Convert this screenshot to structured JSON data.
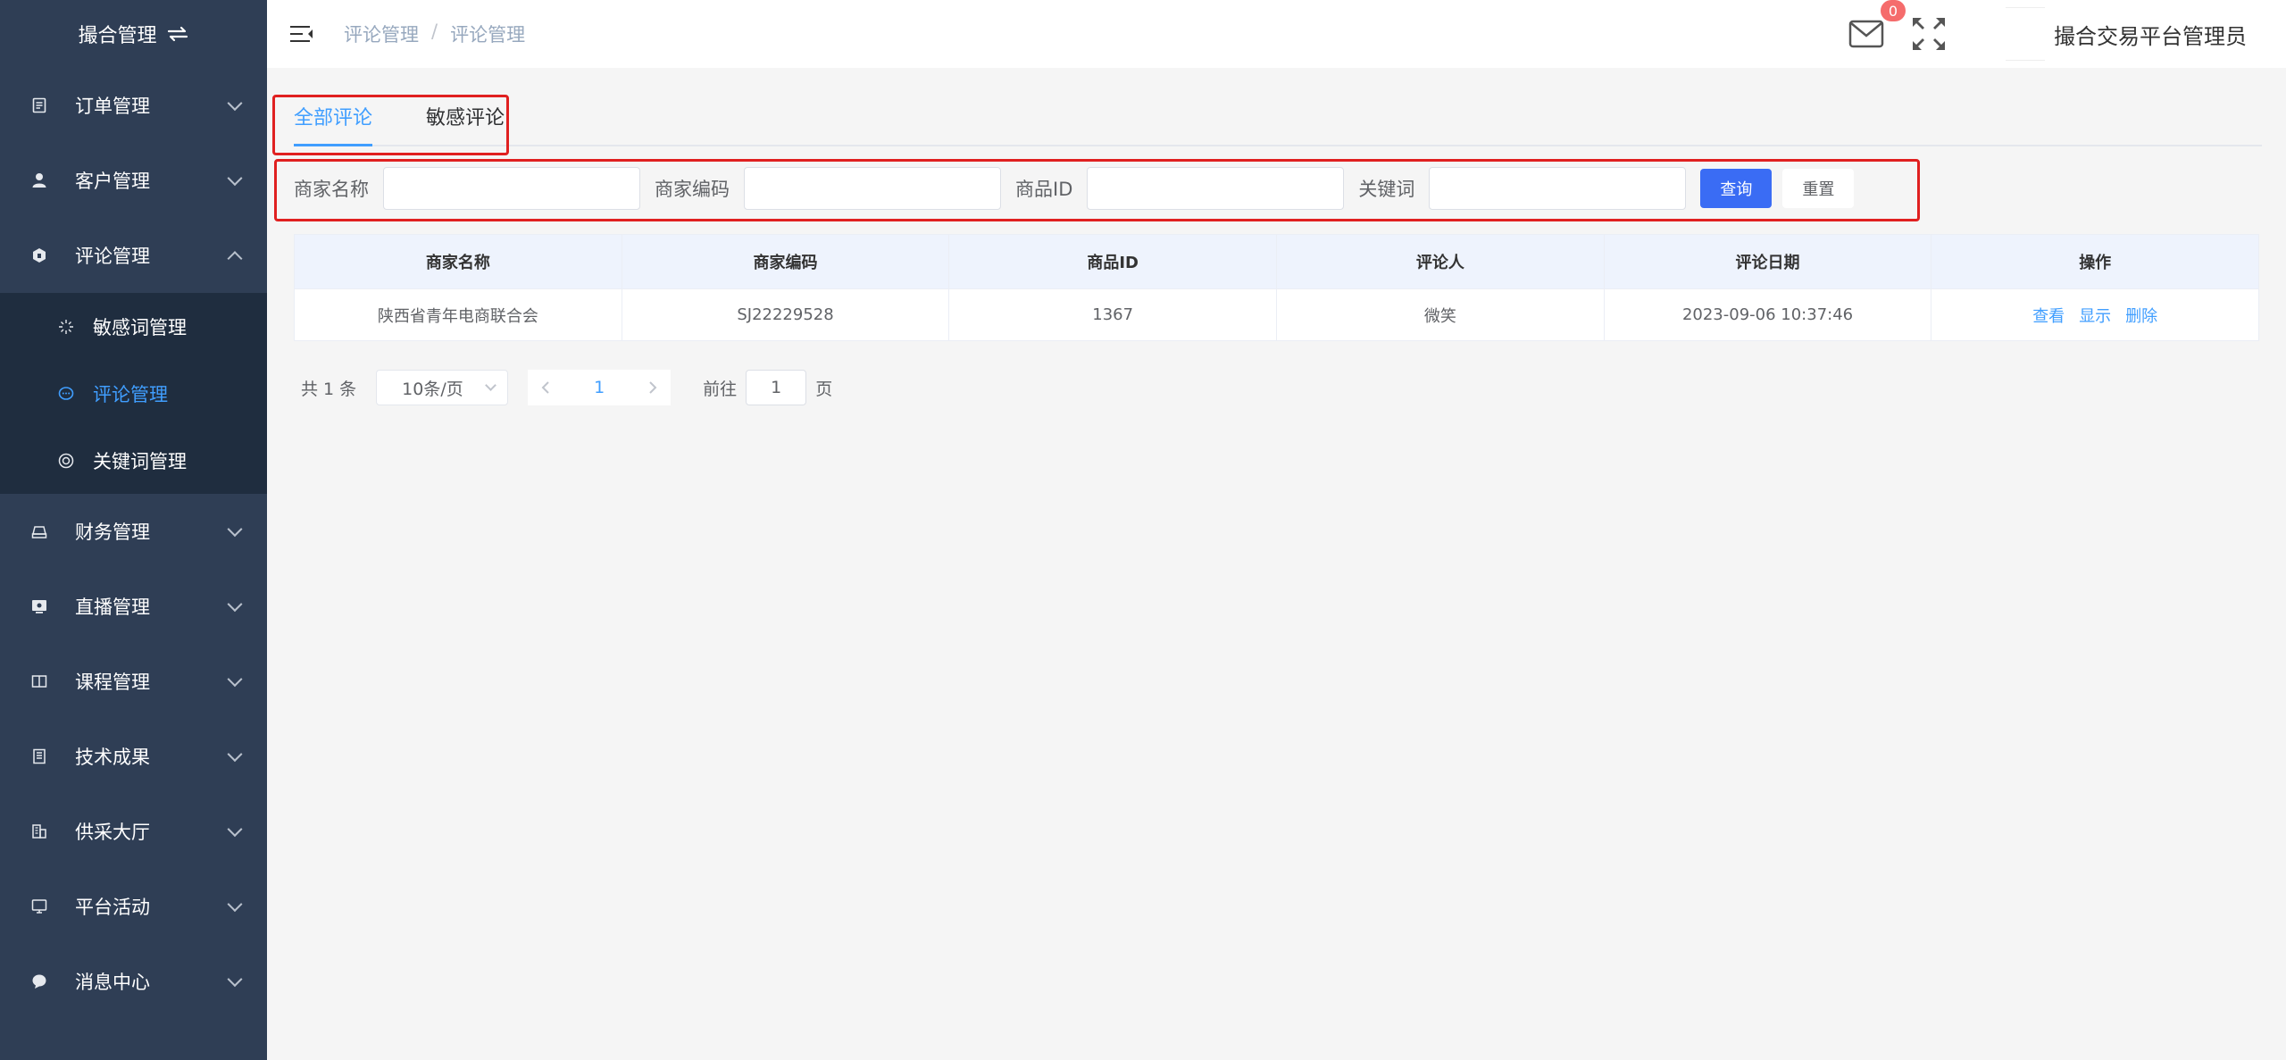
{
  "sidebar": {
    "brand": "撮合管理",
    "items": [
      {
        "label": "订单管理",
        "icon": "document-icon"
      },
      {
        "label": "客户管理",
        "icon": "user-icon"
      },
      {
        "label": "评论管理",
        "icon": "comment-box-icon"
      },
      {
        "label": "财务管理",
        "icon": "finance-icon"
      },
      {
        "label": "直播管理",
        "icon": "live-icon"
      },
      {
        "label": "课程管理",
        "icon": "book-icon"
      },
      {
        "label": "技术成果",
        "icon": "report-icon"
      },
      {
        "label": "供采大厅",
        "icon": "building-icon"
      },
      {
        "label": "平台活动",
        "icon": "monitor-icon"
      },
      {
        "label": "消息中心",
        "icon": "message-icon"
      }
    ],
    "submenu": [
      {
        "label": "敏感词管理",
        "icon": "sparkle-icon"
      },
      {
        "label": "评论管理",
        "icon": "chat-icon"
      },
      {
        "label": "关键词管理",
        "icon": "target-icon"
      }
    ]
  },
  "header": {
    "breadcrumb": [
      "评论管理",
      "评论管理"
    ],
    "separator": "/",
    "badge_count": "0",
    "username": "撮合交易平台管理员"
  },
  "tabs": [
    {
      "label": "全部评论"
    },
    {
      "label": "敏感评论"
    }
  ],
  "filters": {
    "merchant_name": "商家名称",
    "merchant_code": "商家编码",
    "product_id": "商品ID",
    "keyword": "关键词",
    "search_btn": "查询",
    "reset_btn": "重置"
  },
  "table": {
    "columns": [
      "商家名称",
      "商家编码",
      "商品ID",
      "评论人",
      "评论日期",
      "操作"
    ],
    "rows": [
      {
        "merchant": "陕西省青年电商联合会",
        "code": "SJ22229528",
        "product_id": "1367",
        "reviewer": "微笑",
        "date": "2023-09-06 10:37:46"
      }
    ],
    "actions": [
      "查看",
      "显示",
      "删除"
    ]
  },
  "pagination": {
    "total": "共 1 条",
    "page_size": "10条/页",
    "current_page": "1",
    "goto_prefix": "前往",
    "goto_value": "1",
    "goto_suffix": "页"
  },
  "colors": {
    "sidebar_bg": "#2f3e55",
    "submenu_bg": "#1f2d3f",
    "active": "#409eff",
    "primary_button": "#3a6cf4",
    "highlight": "#e02020"
  }
}
